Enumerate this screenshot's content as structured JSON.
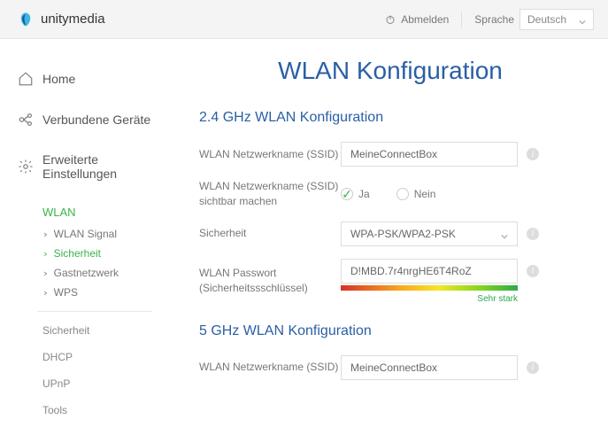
{
  "brand": "unitymedia",
  "topbar": {
    "logout": "Abmelden",
    "language_label": "Sprache",
    "language_value": "Deutsch"
  },
  "nav": {
    "home": "Home",
    "devices": "Verbundene Geräte",
    "advanced": "Erweiterte Einstellungen"
  },
  "subnav": {
    "wlan": "WLAN",
    "signal": "WLAN Signal",
    "security": "Sicherheit",
    "guest": "Gastnetzwerk",
    "wps": "WPS",
    "sec2": "Sicherheit",
    "dhcp": "DHCP",
    "upnp": "UPnP",
    "tools": "Tools"
  },
  "page": {
    "title": "WLAN Konfiguration",
    "section24": "2.4 GHz WLAN Konfiguration",
    "section5": "5 GHz WLAN Konfiguration",
    "ssid_label": "WLAN Netzwerkname (SSID)",
    "ssid_value": "MeineConnectBox",
    "visible_label": "WLAN Netzwerkname (SSID) sichtbar machen",
    "yes": "Ja",
    "no": "Nein",
    "security_label": "Sicherheit",
    "security_value": "WPA-PSK/WPA2-PSK",
    "password_label": "WLAN Passwort (Sicherheitssschlüssel)",
    "password_value": "D!MBD.7r4nrgHE6T4RoZ",
    "strength": "Sehr stark",
    "ssid5_value": "MeineConnectBox"
  }
}
